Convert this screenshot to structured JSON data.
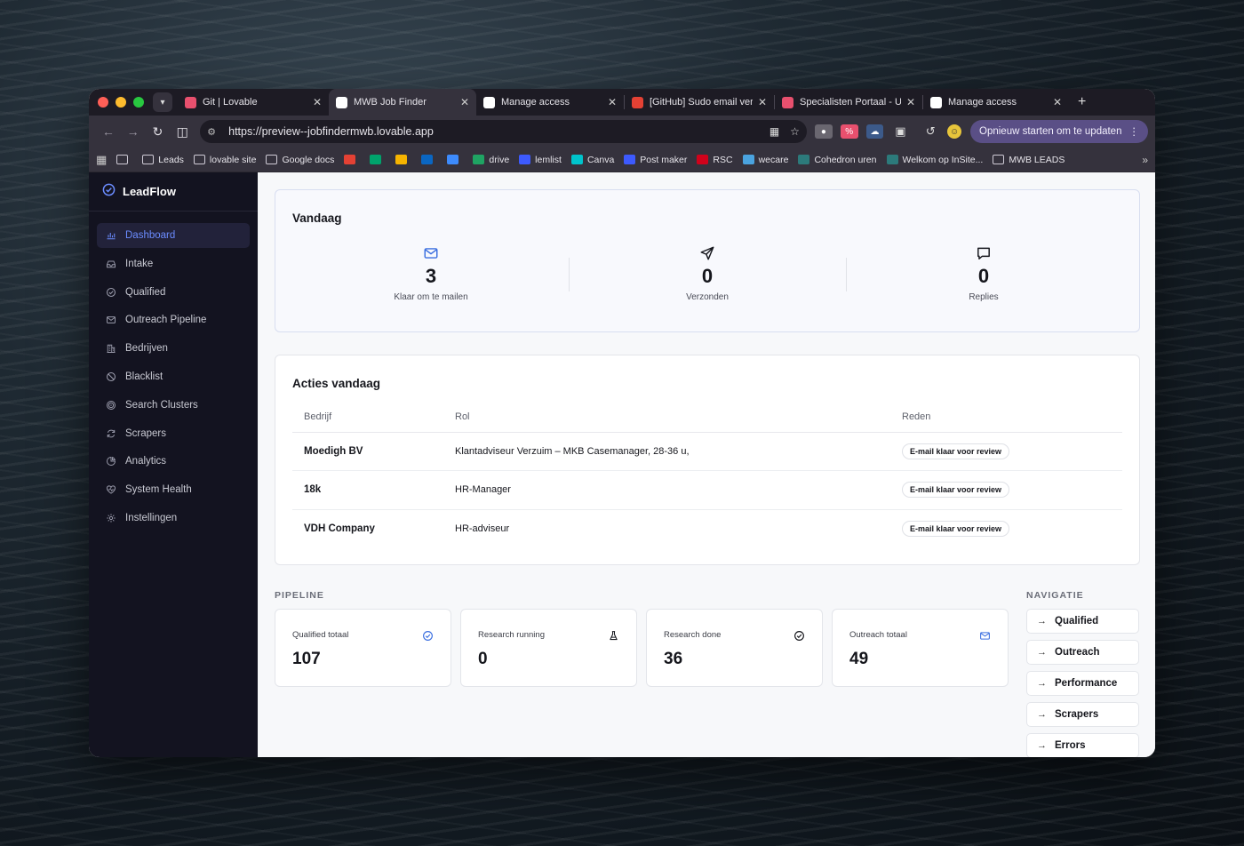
{
  "browser": {
    "tabs": [
      {
        "title": "Git | Lovable",
        "color": "#e8506e",
        "active": false
      },
      {
        "title": "MWB Job Finder",
        "color": "#ffffff",
        "active": true
      },
      {
        "title": "Manage access",
        "color": "#ffffff",
        "active": false
      },
      {
        "title": "[GitHub] Sudo email verif",
        "color": "#e44134",
        "active": false
      },
      {
        "title": "Specialisten Portaal - Ure",
        "color": "#e8506e",
        "active": false
      },
      {
        "title": "Manage access",
        "color": "#ffffff",
        "active": false
      }
    ],
    "url": "https://preview--jobfindermwb.lovable.app",
    "update_button": "Opnieuw starten om te updaten",
    "bookmarks": [
      {
        "label": "",
        "icon": "folder"
      },
      {
        "label": "Leads",
        "icon": "folder"
      },
      {
        "label": "lovable site",
        "icon": "folder"
      },
      {
        "label": "Google docs",
        "icon": "folder"
      },
      {
        "label": "",
        "icon": "gmail",
        "color": "#e44134"
      },
      {
        "label": "",
        "icon": "meet",
        "color": "#00a36c"
      },
      {
        "label": "",
        "icon": "video",
        "color": "#f6b400"
      },
      {
        "label": "",
        "icon": "linkedin",
        "color": "#0a66c2"
      },
      {
        "label": "",
        "icon": "mail",
        "color": "#3d8bfd"
      },
      {
        "label": "drive",
        "icon": "drive",
        "color": "#1fa463"
      },
      {
        "label": "lemlist",
        "icon": "lemlist",
        "color": "#3d5afe"
      },
      {
        "label": "Canva",
        "icon": "canva",
        "color": "#00c4cc"
      },
      {
        "label": "Post maker",
        "icon": "li",
        "color": "#3d5afe"
      },
      {
        "label": "RSC",
        "icon": "rsc",
        "color": "#d0021b"
      },
      {
        "label": "wecare",
        "icon": "wecare",
        "color": "#4aa3df"
      },
      {
        "label": "Cohedron uren",
        "icon": "cohedron",
        "color": "#2c7a7b"
      },
      {
        "label": "Welkom op InSite...",
        "icon": "insite",
        "color": "#2c7a7b"
      },
      {
        "label": "MWB LEADS",
        "icon": "folder"
      }
    ]
  },
  "app": {
    "brand": "LeadFlow",
    "nav": [
      {
        "label": "Dashboard",
        "icon": "chart",
        "active": true
      },
      {
        "label": "Intake",
        "icon": "inbox",
        "active": false
      },
      {
        "label": "Qualified",
        "icon": "check-circle",
        "active": false
      },
      {
        "label": "Outreach Pipeline",
        "icon": "mail",
        "active": false
      },
      {
        "label": "Bedrijven",
        "icon": "building",
        "active": false
      },
      {
        "label": "Blacklist",
        "icon": "ban",
        "active": false
      },
      {
        "label": "Search Clusters",
        "icon": "target",
        "active": false
      },
      {
        "label": "Scrapers",
        "icon": "refresh",
        "active": false
      },
      {
        "label": "Analytics",
        "icon": "pie",
        "active": false
      },
      {
        "label": "System Health",
        "icon": "heart",
        "active": false
      },
      {
        "label": "Instellingen",
        "icon": "gear",
        "active": false
      }
    ]
  },
  "today": {
    "title": "Vandaag",
    "stats": [
      {
        "value": "3",
        "label": "Klaar om te mailen",
        "icon": "mail",
        "color": "#3b6fe0"
      },
      {
        "value": "0",
        "label": "Verzonden",
        "icon": "send",
        "color": "#15161c"
      },
      {
        "value": "0",
        "label": "Replies",
        "icon": "message",
        "color": "#15161c"
      }
    ]
  },
  "acties": {
    "title": "Acties vandaag",
    "columns": [
      "Bedrijf",
      "Rol",
      "Reden"
    ],
    "rows": [
      {
        "bedrijf": "Moedigh BV",
        "rol": "Klantadviseur Verzuim – MKB Casemanager, 28-36 u,",
        "reden": "E-mail klaar voor review"
      },
      {
        "bedrijf": "18k",
        "rol": "HR-Manager",
        "reden": "E-mail klaar voor review"
      },
      {
        "bedrijf": "VDH Company",
        "rol": "HR-adviseur",
        "reden": "E-mail klaar voor review"
      }
    ]
  },
  "pipeline": {
    "label": "PIPELINE",
    "cards": [
      {
        "label": "Qualified totaal",
        "value": "107",
        "icon": "check-circle",
        "color": "#3b6fe0"
      },
      {
        "label": "Research running",
        "value": "0",
        "icon": "flask",
        "color": "#15161c"
      },
      {
        "label": "Research done",
        "value": "36",
        "icon": "check-circle",
        "color": "#15161c"
      },
      {
        "label": "Outreach totaal",
        "value": "49",
        "icon": "mail",
        "color": "#3b6fe0"
      }
    ]
  },
  "navigatie": {
    "label": "NAVIGATIE",
    "links": [
      "Qualified",
      "Outreach",
      "Performance",
      "Scrapers",
      "Errors"
    ]
  }
}
